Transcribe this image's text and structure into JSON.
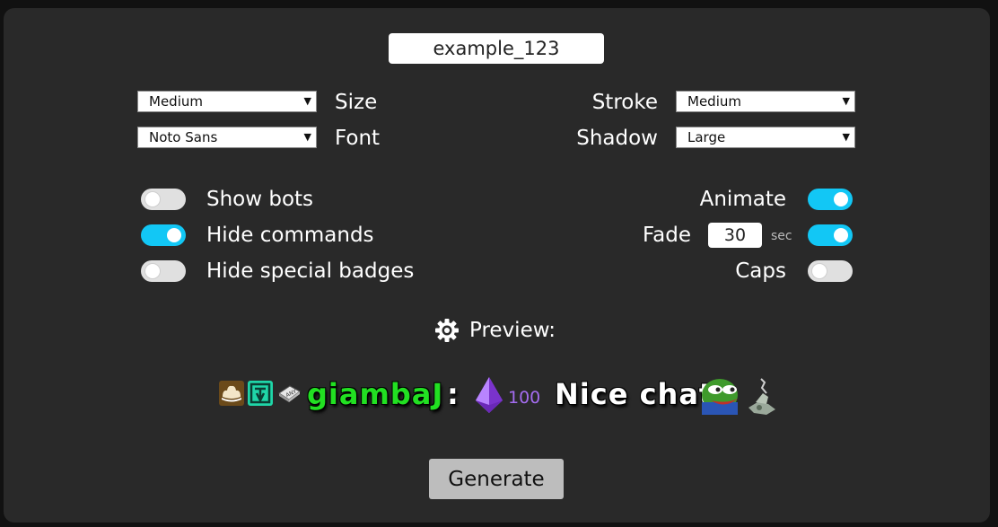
{
  "channel": {
    "value": "example_123"
  },
  "settings": {
    "size": {
      "label": "Size",
      "selected": "Medium"
    },
    "font": {
      "label": "Font",
      "selected": "Noto Sans"
    },
    "stroke": {
      "label": "Stroke",
      "selected": "Medium"
    },
    "shadow": {
      "label": "Shadow",
      "selected": "Large"
    }
  },
  "toggles": {
    "show_bots": {
      "label": "Show bots",
      "on": false
    },
    "hide_commands": {
      "label": "Hide commands",
      "on": true
    },
    "hide_special_badges": {
      "label": "Hide special badges",
      "on": false
    },
    "animate": {
      "label": "Animate",
      "on": true
    },
    "fade": {
      "label": "Fade",
      "on": true,
      "seconds": "30",
      "unit": "sec"
    },
    "caps": {
      "label": "Caps",
      "on": false
    }
  },
  "preview": {
    "label": "Preview:",
    "username": "giambaJ",
    "separator": ":",
    "bits": "100",
    "message": "Nice chat",
    "username_color": "#22e022",
    "bits_color": "#a46cf0"
  },
  "actions": {
    "generate": "Generate"
  },
  "colors": {
    "accent": "#12c7f5",
    "panel": "#292929",
    "background": "#111111"
  }
}
